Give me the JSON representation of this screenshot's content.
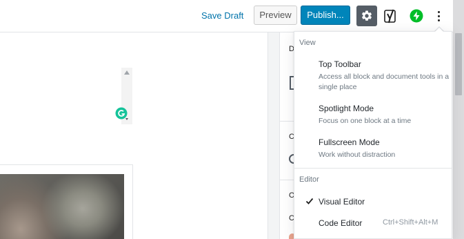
{
  "toolbar": {
    "save_draft": "Save Draft",
    "preview": "Preview",
    "publish": "Publish...",
    "settings_icon": "gear-icon",
    "yoast_icon": "yoast-icon",
    "jetpack_icon": "jetpack-bolt-icon",
    "more_icon": "more-vertical-icon"
  },
  "colors": {
    "accent": "#0085ba",
    "link": "#0073aa",
    "jetpack": "#00be28",
    "grammarly": "#15c39a"
  },
  "sidebar": {
    "letters": [
      "D",
      "C",
      "O",
      "C"
    ]
  },
  "menu": {
    "view_label": "View",
    "items": [
      {
        "title": "Top Toolbar",
        "desc": "Access all block and document tools in a single place"
      },
      {
        "title": "Spotlight Mode",
        "desc": "Focus on one block at a time"
      },
      {
        "title": "Fullscreen Mode",
        "desc": "Work without distraction"
      }
    ],
    "editor_label": "Editor",
    "visual_editor": "Visual Editor",
    "code_editor": "Code Editor",
    "code_editor_shortcut": "Ctrl+Shift+Alt+M"
  }
}
